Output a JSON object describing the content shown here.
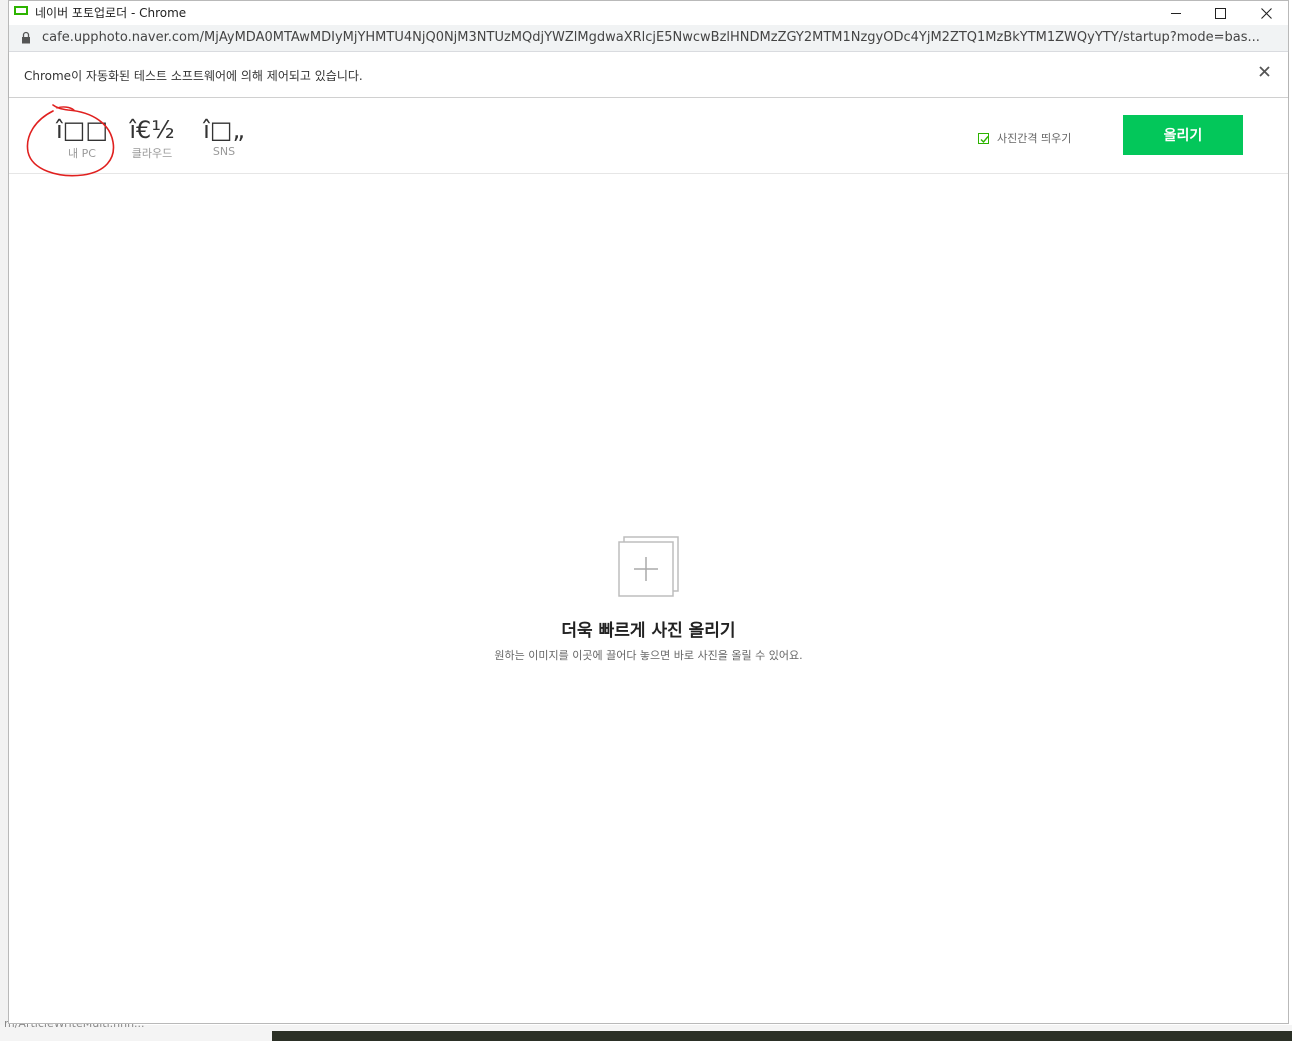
{
  "window": {
    "title": "네이버 포토업로더 - Chrome",
    "url": "cafe.upphoto.naver.com/MjAyMDA0MTAwMDIyMjYHMTU4NjQ0NjM3NTUzMQdjYWZlMgdwaXRlcjE5NwcwBzlHNDMzZGY2MTM1NzgyODc4YjM2ZTQ1MzBkYTM1ZWQyYTY/startup?mode=bas..."
  },
  "infobar": {
    "message": "Chrome이 자동화된 테스트 소프트웨어에 의해 제어되고 있습니다.",
    "close": "✕"
  },
  "tabs": [
    {
      "glyph": "î□□",
      "label": "내 PC"
    },
    {
      "glyph": "î€½",
      "label": "클라우드"
    },
    {
      "glyph": "î□„",
      "label": "SNS"
    }
  ],
  "toolbar": {
    "spacing_label": "사진간격 띄우기",
    "spacing_checked": true,
    "upload_label": "올리기"
  },
  "dropzone": {
    "title": "더욱 빠르게 사진 올리기",
    "description": "원하는 이미지를 이곳에 끌어다 놓으면 바로 사진을 올릴 수 있어요."
  },
  "colors": {
    "brand_green": "#03c75a",
    "annotation_red": "#e0201f"
  },
  "background": {
    "status_text": "m/ArticleWriteMulti.nhn... "
  }
}
